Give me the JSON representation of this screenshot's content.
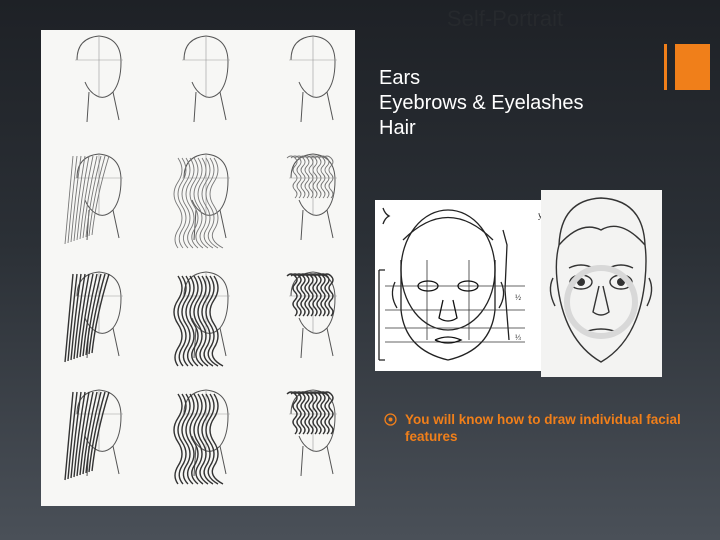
{
  "slide": {
    "title": "Self-Portrait",
    "accent_color": "#f07f1a",
    "bullets": [
      "Ears",
      "Eyebrows & Eyelashes",
      "Hair"
    ],
    "takeaway": "You will know how to draw individual facial features",
    "takeaway_color": "#f07f1a",
    "bullet_icon": "circled-dot-icon"
  },
  "images": {
    "hair_steps": "hair-drawing-steps-illustration",
    "face_proportions": "face-proportion-diagram",
    "face_sketch": "pencil-face-sketch"
  }
}
